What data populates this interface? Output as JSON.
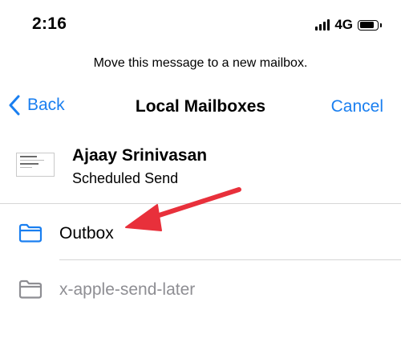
{
  "status_bar": {
    "time": "2:16",
    "network": "4G",
    "signal_bars_filled": 4,
    "battery_level": 0.85
  },
  "prompt": "Move this message to a new mailbox.",
  "nav": {
    "back_label": "Back",
    "title": "Local Mailboxes",
    "cancel_label": "Cancel"
  },
  "message": {
    "sender": "Ajaay Srinivasan",
    "subject": "Scheduled Send"
  },
  "mailboxes": [
    {
      "label": "Outbox",
      "icon": "folder-icon",
      "enabled": true
    },
    {
      "label": "x-apple-send-later",
      "icon": "folder-icon",
      "enabled": false
    }
  ],
  "colors": {
    "accent": "#1a7ff0",
    "folder_enabled": "#1a7ff0",
    "folder_disabled": "#8e8e93",
    "annotation_arrow": "#e8303b"
  }
}
